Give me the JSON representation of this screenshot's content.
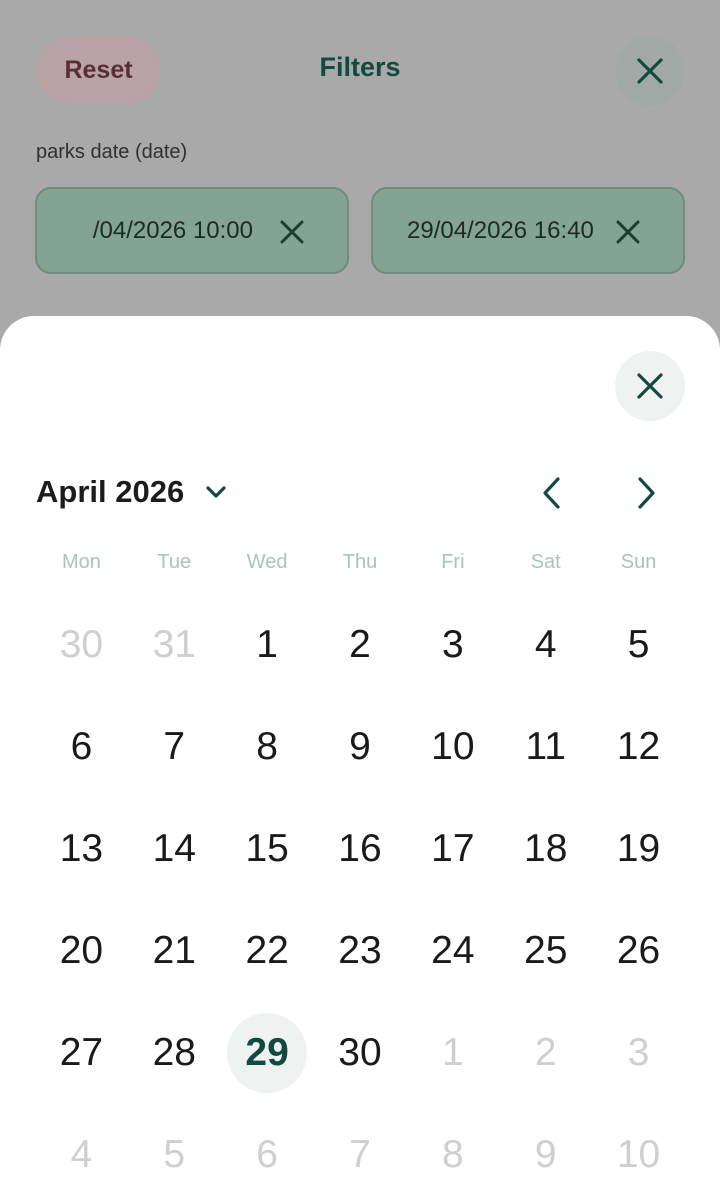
{
  "filters": {
    "reset_label": "Reset",
    "title": "Filters",
    "field_label": "parks date (date)",
    "start_value": "/04/2026 10:00",
    "end_value": "29/04/2026 16:40"
  },
  "calendar": {
    "month_label": "April 2026",
    "weekdays": [
      "Mon",
      "Tue",
      "Wed",
      "Thu",
      "Fri",
      "Sat",
      "Sun"
    ],
    "days": [
      {
        "label": "30",
        "muted": true
      },
      {
        "label": "31",
        "muted": true
      },
      {
        "label": "1"
      },
      {
        "label": "2"
      },
      {
        "label": "3"
      },
      {
        "label": "4"
      },
      {
        "label": "5"
      },
      {
        "label": "6"
      },
      {
        "label": "7"
      },
      {
        "label": "8"
      },
      {
        "label": "9"
      },
      {
        "label": "10"
      },
      {
        "label": "11"
      },
      {
        "label": "12"
      },
      {
        "label": "13"
      },
      {
        "label": "14"
      },
      {
        "label": "15"
      },
      {
        "label": "16"
      },
      {
        "label": "17"
      },
      {
        "label": "18"
      },
      {
        "label": "19"
      },
      {
        "label": "20"
      },
      {
        "label": "21"
      },
      {
        "label": "22"
      },
      {
        "label": "23"
      },
      {
        "label": "24"
      },
      {
        "label": "25"
      },
      {
        "label": "26"
      },
      {
        "label": "27"
      },
      {
        "label": "28"
      },
      {
        "label": "29",
        "selected": true
      },
      {
        "label": "30"
      },
      {
        "label": "1",
        "muted": true
      },
      {
        "label": "2",
        "muted": true
      },
      {
        "label": "3",
        "muted": true
      },
      {
        "label": "4",
        "muted": true
      },
      {
        "label": "5",
        "muted": true
      },
      {
        "label": "6",
        "muted": true
      },
      {
        "label": "7",
        "muted": true
      },
      {
        "label": "8",
        "muted": true
      },
      {
        "label": "9",
        "muted": true
      },
      {
        "label": "10",
        "muted": true
      }
    ]
  },
  "colors": {
    "accent": "#134a40",
    "selected_bg": "#eef3f1",
    "weekday": "#a6c5bb",
    "muted_day": "#cfcfcf"
  },
  "icons": {
    "close": "close-icon",
    "clear": "clear-icon",
    "month_dropdown": "chevron-down-icon",
    "prev": "chevron-left-icon",
    "next": "chevron-right-icon"
  }
}
